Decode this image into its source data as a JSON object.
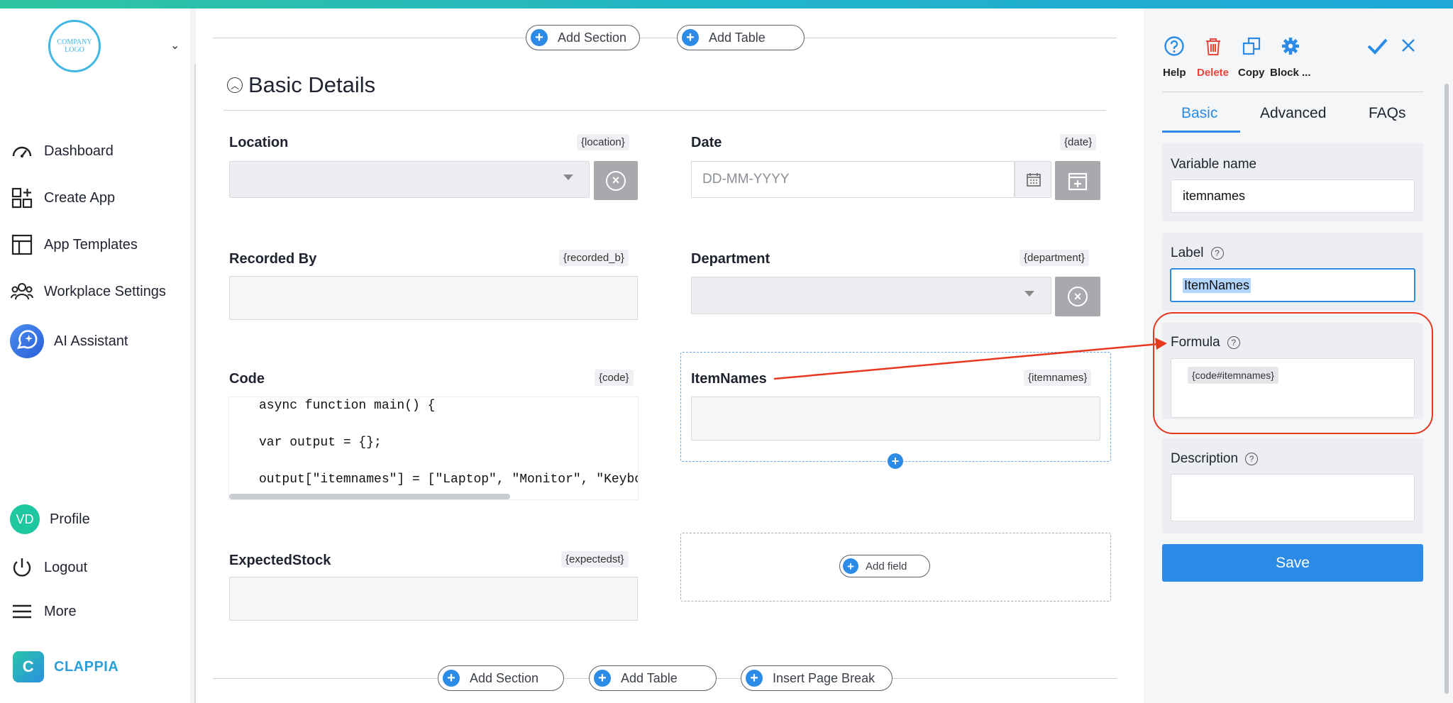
{
  "sidebar": {
    "logo_text": "COMPANY LOGO",
    "nav": [
      {
        "label": "Dashboard",
        "icon": "gauge-icon"
      },
      {
        "label": "Create App",
        "icon": "create-app-icon"
      },
      {
        "label": "App Templates",
        "icon": "templates-icon"
      },
      {
        "label": "Workplace Settings",
        "icon": "people-icon"
      },
      {
        "label": "AI Assistant",
        "icon": "ai-assistant-icon"
      }
    ],
    "profile": {
      "initials": "VD",
      "label": "Profile"
    },
    "logout_label": "Logout",
    "more_label": "More",
    "brand_name": "CLAPPIA",
    "brand_mark": "C"
  },
  "main": {
    "top_buttons": {
      "add_section": "Add Section",
      "add_table": "Add Table"
    },
    "section_title": "Basic Details",
    "fields": {
      "location": {
        "label": "Location",
        "tag": "{location}"
      },
      "date": {
        "label": "Date",
        "tag": "{date}",
        "placeholder": "DD-MM-YYYY"
      },
      "recorded_by": {
        "label": "Recorded By",
        "tag": "{recorded_b}"
      },
      "department": {
        "label": "Department",
        "tag": "{department}"
      },
      "code": {
        "label": "Code",
        "tag": "{code}",
        "lines": [
          "async function main() {",
          "var output = {};",
          "output[\"itemnames\"] = [\"Laptop\", \"Monitor\", \"Keyboa"
        ]
      },
      "itemnames": {
        "label": "ItemNames",
        "tag": "{itemnames}"
      },
      "expectedstock": {
        "label": "ExpectedStock",
        "tag": "{expectedst}"
      }
    },
    "add_field_label": "Add field",
    "bottom_buttons": {
      "add_section": "Add Section",
      "add_table": "Add Table",
      "insert_page_break": "Insert Page Break"
    }
  },
  "panel": {
    "toolbar": {
      "help": "Help",
      "delete": "Delete",
      "copy": "Copy",
      "block": "Block ..."
    },
    "tabs": [
      "Basic",
      "Advanced",
      "FAQs"
    ],
    "active_tab": "Basic",
    "variable_name": {
      "label": "Variable name",
      "value": "itemnames"
    },
    "label": {
      "label": "Label",
      "value": "ItemNames"
    },
    "formula": {
      "label": "Formula",
      "chip": "{code#itemnames}"
    },
    "description": {
      "label": "Description",
      "value": ""
    },
    "save_label": "Save"
  },
  "colors": {
    "accent": "#2b8be6",
    "delete": "#e8463a",
    "annotation": "#e8371f",
    "brand": "#2a9fd8"
  }
}
